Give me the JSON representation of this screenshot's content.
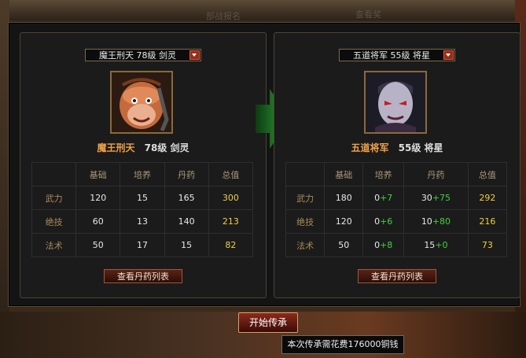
{
  "background": {
    "text_a": "部战报名",
    "text_b": "查看奖"
  },
  "source": {
    "selector": "魔王刑天 78级 剑灵",
    "name": "魔王刑天",
    "level": "78级",
    "class": "剑灵",
    "headers": [
      "",
      "基础",
      "培养",
      "丹药",
      "总值"
    ],
    "rows": [
      {
        "label": "武力",
        "base": "120",
        "train": "15",
        "pill": "165",
        "total": "300"
      },
      {
        "label": "绝技",
        "base": "60",
        "train": "13",
        "pill": "140",
        "total": "213"
      },
      {
        "label": "法术",
        "base": "50",
        "train": "17",
        "pill": "15",
        "total": "82"
      }
    ],
    "pill_button": "查看丹药列表"
  },
  "target": {
    "selector": "五道将军 55级 将星",
    "name": "五道将军",
    "level": "55级",
    "class": "将星",
    "headers": [
      "",
      "基础",
      "培养",
      "丹药",
      "总值"
    ],
    "rows": [
      {
        "label": "武力",
        "base": "180",
        "train_a": "0",
        "train_b": "+7",
        "pill_a": "30",
        "pill_b": "+75",
        "total": "292"
      },
      {
        "label": "绝技",
        "base": "120",
        "train_a": "0",
        "train_b": "+6",
        "pill_a": "10",
        "pill_b": "+80",
        "total": "216"
      },
      {
        "label": "法术",
        "base": "50",
        "train_a": "0",
        "train_b": "+8",
        "pill_a": "15",
        "pill_b": "+0",
        "total": "73"
      }
    ],
    "pill_button": "查看丹药列表"
  },
  "start_button": "开始传承",
  "cost_tooltip": "本次传承需花费176000铜钱",
  "colors": {
    "name": "#f0a24a",
    "total": "#f0d040",
    "bonus": "#3ed23e",
    "arrow": "#2fa83a"
  }
}
